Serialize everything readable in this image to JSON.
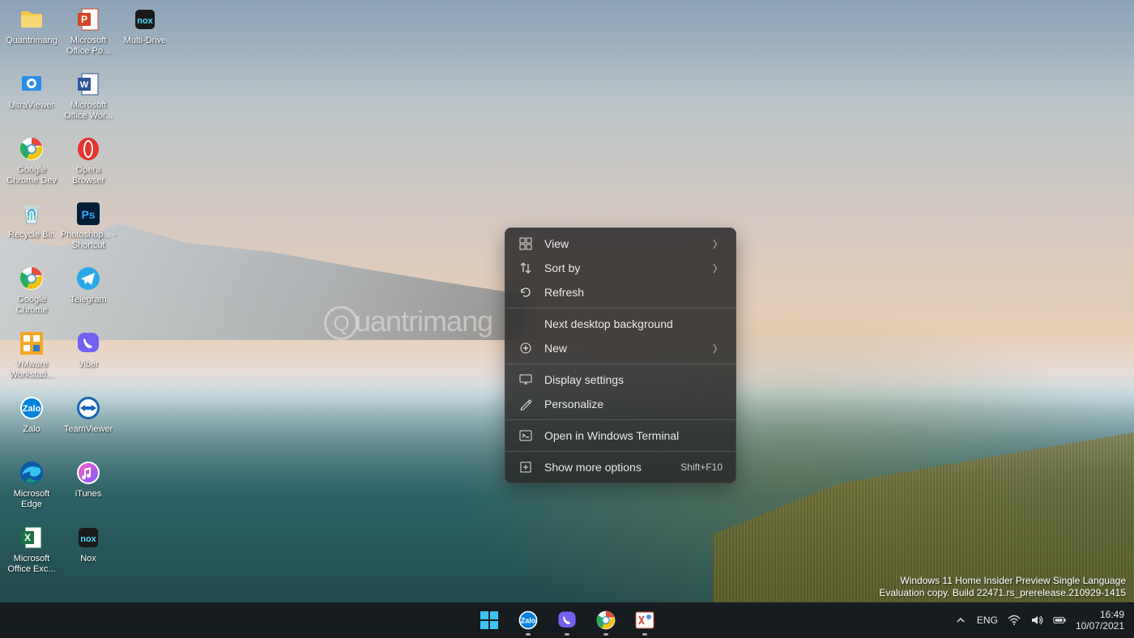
{
  "desktop_icons": [
    {
      "label": "Quantrimang",
      "icon": "folder"
    },
    {
      "label": "UltraViewer",
      "icon": "ultraviewer"
    },
    {
      "label": "Google Chrome Dev",
      "icon": "chrome-dev"
    },
    {
      "label": "Recycle Bin",
      "icon": "recycle-bin"
    },
    {
      "label": "Google Chrome",
      "icon": "chrome"
    },
    {
      "label": "VMware Workstati...",
      "icon": "vmware"
    },
    {
      "label": "Zalo",
      "icon": "zalo"
    },
    {
      "label": "Microsoft Edge",
      "icon": "edge"
    },
    {
      "label": "Microsoft Office Exc...",
      "icon": "excel"
    },
    {
      "label": "Microsoft Office Po...",
      "icon": "powerpoint"
    },
    {
      "label": "Microsoft Office Wor...",
      "icon": "word"
    },
    {
      "label": "Opera Browser",
      "icon": "opera"
    },
    {
      "label": "Photoshop... - Shortcut",
      "icon": "photoshop"
    },
    {
      "label": "Telegram",
      "icon": "telegram"
    },
    {
      "label": "Viber",
      "icon": "viber"
    },
    {
      "label": "TeamViewer",
      "icon": "teamviewer"
    },
    {
      "label": "iTunes",
      "icon": "itunes"
    },
    {
      "label": "Nox",
      "icon": "nox"
    },
    {
      "label": "Multi-Drive",
      "icon": "multi-drive"
    }
  ],
  "context_menu": {
    "items": [
      {
        "icon": "view",
        "label": "View",
        "arrow": true
      },
      {
        "icon": "sort",
        "label": "Sort by",
        "arrow": true
      },
      {
        "icon": "refresh",
        "label": "Refresh"
      },
      {
        "sep": true
      },
      {
        "icon": "",
        "label": "Next desktop background"
      },
      {
        "icon": "new",
        "label": "New",
        "arrow": true
      },
      {
        "sep": true
      },
      {
        "icon": "display",
        "label": "Display settings"
      },
      {
        "icon": "personalize",
        "label": "Personalize"
      },
      {
        "sep": true
      },
      {
        "icon": "terminal",
        "label": "Open in Windows Terminal"
      },
      {
        "sep": true
      },
      {
        "icon": "more",
        "label": "Show more options",
        "shortcut": "Shift+F10"
      }
    ]
  },
  "taskbar": {
    "items": [
      {
        "name": "start",
        "running": false
      },
      {
        "name": "zalo",
        "running": true
      },
      {
        "name": "viber",
        "running": true
      },
      {
        "name": "chrome",
        "running": true
      },
      {
        "name": "snip",
        "running": true
      }
    ]
  },
  "tray": {
    "lang": "ENG",
    "time": "16:49",
    "date": "10/07/2021"
  },
  "eval": {
    "line1": "Windows 11 Home Insider Preview Single Language",
    "line2": "Evaluation copy. Build 22471.rs_prerelease.210929-1415"
  },
  "watermark": "uantrimang"
}
